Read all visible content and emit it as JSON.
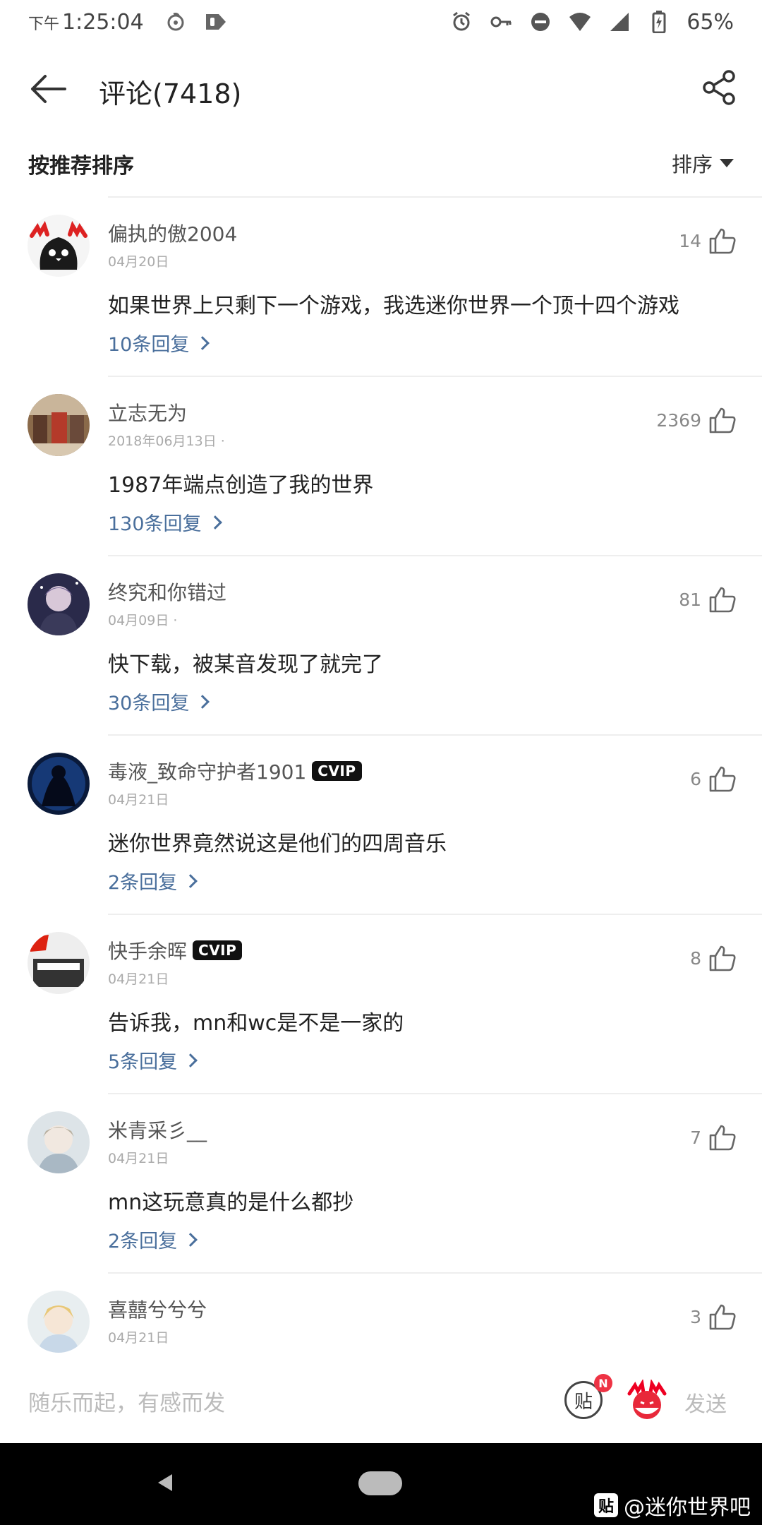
{
  "status_bar": {
    "ampm": "下午",
    "time": "1:25:04",
    "battery": "65%"
  },
  "header": {
    "title": "评论(7418)"
  },
  "sort": {
    "label": "按推荐排序",
    "toggle": "排序"
  },
  "comments": [
    {
      "user": "偏执的傲2004",
      "date": "04月20日",
      "text": "如果世界上只剩下一个游戏，我选迷你世界一个顶十四个游戏",
      "replies": "10条回复",
      "likes": "14",
      "vip": ""
    },
    {
      "user": "立志无为",
      "date": "2018年06月13日 ·",
      "text": "1987年端点创造了我的世界",
      "replies": "130条回复",
      "likes": "2369",
      "vip": ""
    },
    {
      "user": "终究和你错过",
      "date": "04月09日 ·",
      "text": "快下载，被某音发现了就完了",
      "replies": "30条回复",
      "likes": "81",
      "vip": ""
    },
    {
      "user": "毒液_致命守护者1901",
      "date": "04月21日",
      "text": "迷你世界竟然说这是他们的四周音乐",
      "replies": "2条回复",
      "likes": "6",
      "vip": "CVIP"
    },
    {
      "user": "快手余晖",
      "date": "04月21日",
      "text": "告诉我，mn和wc是不是一家的",
      "replies": "5条回复",
      "likes": "8",
      "vip": "CVIP"
    },
    {
      "user": "米青采彡__",
      "date": "04月21日",
      "text": "mn这玩意真的是什么都抄",
      "replies": "2条回复",
      "likes": "7",
      "vip": ""
    },
    {
      "user": "喜囍兮兮兮",
      "date": "04月21日",
      "text": "",
      "replies": "",
      "likes": "3",
      "vip": ""
    }
  ],
  "composer": {
    "placeholder": "随乐而起，有感而发",
    "tie_label": "贴",
    "badge": "N",
    "send": "发送"
  },
  "watermark": {
    "logo": "贴",
    "text": "@迷你世界吧"
  },
  "colors": {
    "link": "#4a6f9c",
    "badge": "#ee3344"
  }
}
